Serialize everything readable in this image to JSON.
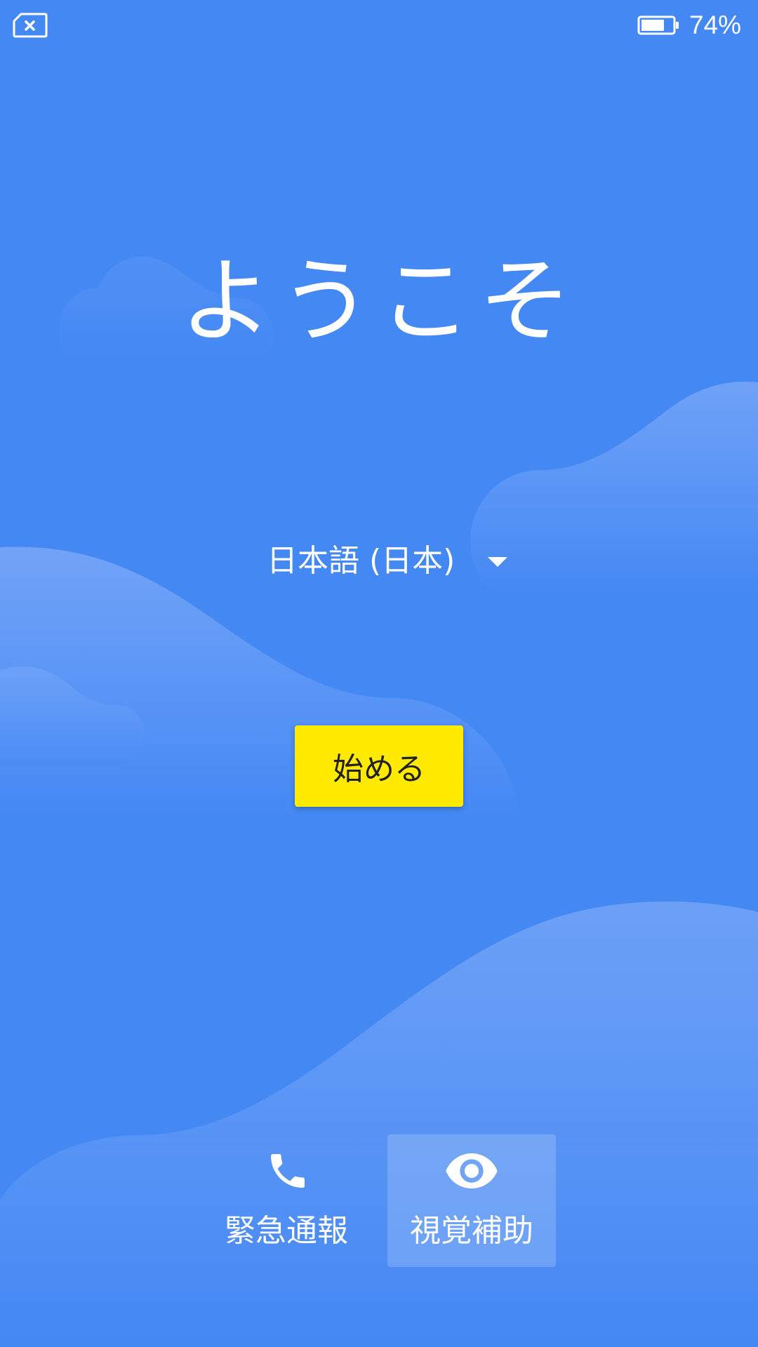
{
  "status_bar": {
    "sim_icon": "no-sim-icon",
    "battery_icon": "battery-icon",
    "battery_percent": "74%"
  },
  "welcome": {
    "title": "ようこそ"
  },
  "language": {
    "selected": "日本語 (日本)",
    "dropdown_icon": "dropdown-arrow-icon"
  },
  "start_button": {
    "label": "始める"
  },
  "bottom_actions": {
    "emergency": {
      "icon": "phone-icon",
      "label": "緊急通報"
    },
    "vision": {
      "icon": "eye-icon",
      "label": "視覚補助"
    }
  },
  "colors": {
    "background": "#4488F4",
    "start_button": "#FFEA00",
    "text": "#FFFFFF",
    "button_text": "#212121"
  }
}
